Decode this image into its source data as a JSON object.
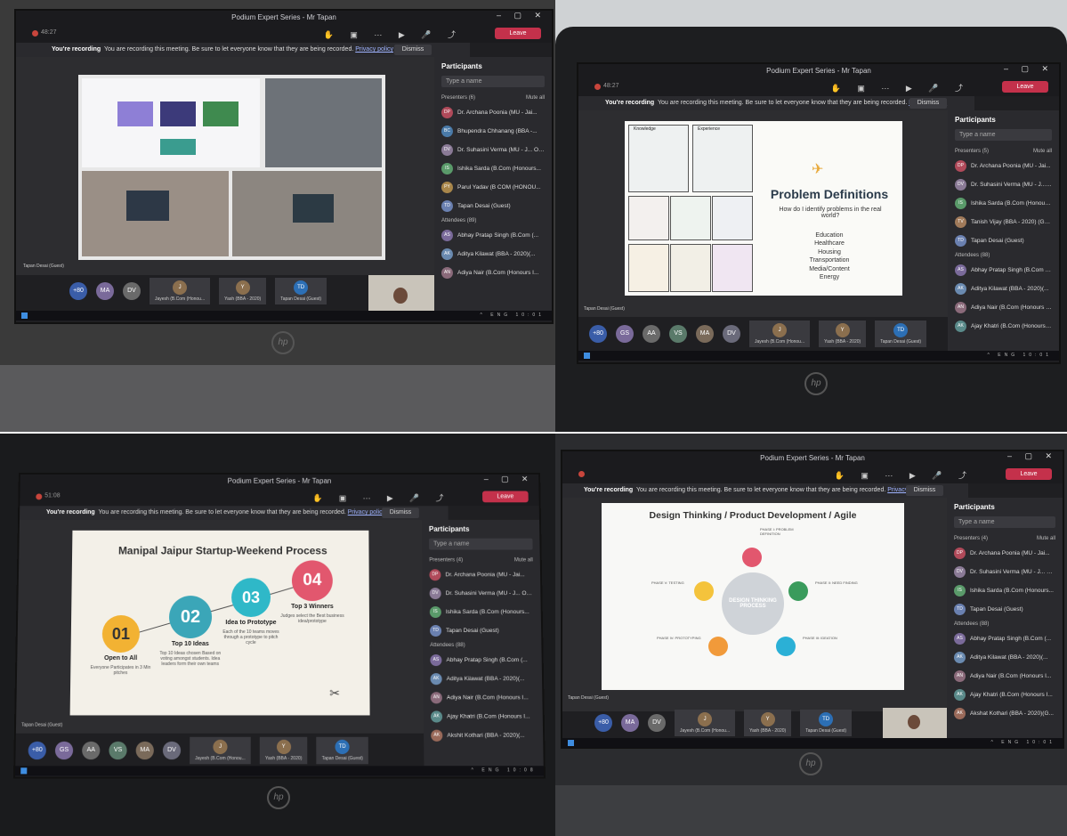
{
  "common": {
    "title": "Podium Expert Series - Mr Tapan",
    "recording_label": "You're recording",
    "recording_text": "You are recording this meeting. Be sure to let everyone know that they are being recorded.",
    "privacy": "Privacy policy",
    "dismiss": "Dismiss",
    "leave": "Leave",
    "participants": "Participants",
    "search_placeholder": "Type a name",
    "mute_all": "Mute all",
    "presenters": "Presenters",
    "attendees": "Attendees",
    "hp": "hp",
    "presenter_caption": "Tapan Desai (Guest)"
  },
  "panels": [
    {
      "timer": "48:27",
      "presenters_count": "(6)",
      "attendees_count": "(89)",
      "participants": [
        "Dr. Archana Poonia (MU - Jai...",
        "Bhupendra Chhanang (BBA -...",
        "Dr. Suhasini Verma (MU - J... On hold",
        "Ishika Sarda (B.Com (Honours...",
        "Parul Yadav (B COM (HONOU...",
        "Tapan Desai (Guest)",
        "Abhay Pratap Singh (B.Com (...",
        "Aditya Kilawat (BBA - 2020)(...",
        "Adiya Nair (B.Com (Honours I..."
      ],
      "initials": [
        "DP",
        "BC",
        "DV",
        "IS",
        "PY",
        "TD",
        "AS",
        "AK",
        "AN"
      ],
      "avatar_colors": [
        "#b04a5a",
        "#4a7aa8",
        "#8a7a96",
        "#5a9a6a",
        "#a8864a",
        "#6a80b0",
        "#7a6a9a",
        "#6a8ab0",
        "#8a6a7a"
      ],
      "gallery": [
        "+80",
        "MA",
        "DV"
      ],
      "tiles": [
        "Jayesh (B.Com (Honou...",
        "Yash (BBA - 2020)",
        "Tapan Desai (Guest)"
      ],
      "tile_initials": [
        "J",
        "Y",
        "TD"
      ]
    },
    {
      "timer": "48:27",
      "presenters_count": "(5)",
      "attendees_count": "(88)",
      "participants": [
        "Dr. Archana Poonia (MU - Jai...",
        "Dr. Suhasini Verma (MU - J... On hold",
        "Ishika Sarda (B.Com (Honours...",
        "Tanish Vijay (BBA - 2020) (Gu...",
        "Tapan Desai (Guest)",
        "Abhay Pratap Singh (B.Com (...",
        "Aditya Kilawat (BBA - 2020)(...",
        "Adiya Nair (B.Com (Honours I...",
        "Ajay Khatri (B.Com (Honours I..."
      ],
      "initials": [
        "DP",
        "DV",
        "IS",
        "TV",
        "TD",
        "AS",
        "AK",
        "AN",
        "AK"
      ],
      "avatar_colors": [
        "#b04a5a",
        "#8a7a96",
        "#5a9a6a",
        "#a07a5a",
        "#6a80b0",
        "#7a6a9a",
        "#6a8ab0",
        "#8a6a7a",
        "#5a8a8a"
      ],
      "gallery": [
        "+80",
        "GS",
        "AA",
        "VS",
        "MA",
        "DV"
      ],
      "tiles": [
        "Jayesh (B.Com (Honou...",
        "Yash (BBA - 2020)",
        "Tapan Desai (Guest)"
      ],
      "tile_initials": [
        "J",
        "Y",
        "TD"
      ],
      "slide": {
        "title": "Problem Definitions",
        "question": "How do I identify problems in the real world?",
        "list": [
          "Education",
          "Healthcare",
          "Housing",
          "Transportation",
          "Media/Content",
          "Energy"
        ],
        "grid_labels": [
          "Knowledge",
          "Experience"
        ]
      }
    },
    {
      "timer": "51:08",
      "presenters_count": "(4)",
      "attendees_count": "(88)",
      "participants": [
        "Dr. Archana Poonia (MU - Jai...",
        "Dr. Suhasini Verma (MU - J... On hold",
        "Ishika Sarda (B.Com (Honours...",
        "Tapan Desai (Guest)",
        "Abhay Pratap Singh (B.Com (...",
        "Aditya Kilawat (BBA - 2020)(...",
        "Adiya Nair (B.Com (Honours I...",
        "Ajay Khatri (B.Com (Honours I...",
        "Akshit Kothari (BBA - 2020)(..."
      ],
      "initials": [
        "DP",
        "DV",
        "IS",
        "TD",
        "AS",
        "AK",
        "AN",
        "AK",
        "AK"
      ],
      "avatar_colors": [
        "#b04a5a",
        "#8a7a96",
        "#5a9a6a",
        "#6a80b0",
        "#7a6a9a",
        "#6a8ab0",
        "#8a6a7a",
        "#5a8a8a",
        "#9a6a5a"
      ],
      "gallery": [
        "+80",
        "GS",
        "AA",
        "VS",
        "MA",
        "DV"
      ],
      "tiles": [
        "Jayesh (B.Com (Honou...",
        "Yash (BBA - 2020)",
        "Tapan Desai (Guest)"
      ],
      "tile_initials": [
        "J",
        "Y",
        "TD"
      ],
      "slide": {
        "title": "Manipal Jaipur Startup-Weekend Process",
        "steps": [
          {
            "num": "01",
            "label": "Open to All",
            "desc": "Everyone Participates in 3 Min pitches"
          },
          {
            "num": "02",
            "label": "Top 10 Ideas",
            "desc": "Top 10 Ideas chosen Based on voting amongst students. Idea leaders form their own teams"
          },
          {
            "num": "03",
            "label": "Idea to Prototype",
            "desc": "Each of the 10 teams moves through a prototype to pitch cycle"
          },
          {
            "num": "04",
            "label": "Top 3 Winners",
            "desc": "Judges select the Best business idea/prototype"
          }
        ]
      }
    },
    {
      "timer": "",
      "presenters_count": "(4)",
      "attendees_count": "(88)",
      "participants": [
        "Dr. Archana Poonia (MU - Jai...",
        "Dr. Suhasini Verma (MU - J... On hold",
        "Ishika Sarda (B.Com (Honours...",
        "Tapan Desai (Guest)",
        "Abhay Pratap Singh (B.Com (...",
        "Aditya Kilawat (BBA - 2020)(...",
        "Adiya Nair (B.Com (Honours I...",
        "Ajay Khatri (B.Com (Honours I...",
        "Akshat Kothari (BBA - 2020)(G..."
      ],
      "initials": [
        "DP",
        "DV",
        "IS",
        "TD",
        "AS",
        "AK",
        "AN",
        "AK",
        "AK"
      ],
      "avatar_colors": [
        "#b04a5a",
        "#8a7a96",
        "#5a9a6a",
        "#6a80b0",
        "#7a6a9a",
        "#6a8ab0",
        "#8a6a7a",
        "#5a8a8a",
        "#9a6a5a"
      ],
      "gallery": [
        "+80",
        "MA",
        "DV"
      ],
      "tiles": [
        "Jayesh (B.Com (Honou...",
        "Yash (BBA - 2020)",
        "Tapan Desai (Guest)"
      ],
      "tile_initials": [
        "J",
        "Y",
        "TD"
      ],
      "slide": {
        "title": "Design Thinking / Product Development / Agile",
        "center": "DESIGN THINKING PROCESS",
        "phases": [
          "PHASE I: PROBLEM DEFINITION",
          "PHASE II: NEED FINDING",
          "PHASE III: IDEATION",
          "PHASE IV: PROTOTYPING",
          "PHASE V: TESTING"
        ]
      }
    }
  ],
  "colors": {
    "teams_bg": "#1f1f22",
    "leave_red": "#c4314b",
    "step1": "#f2b233",
    "step2": "#3ba6b8",
    "step3": "#2fb8c8",
    "step4": "#e2576e"
  }
}
